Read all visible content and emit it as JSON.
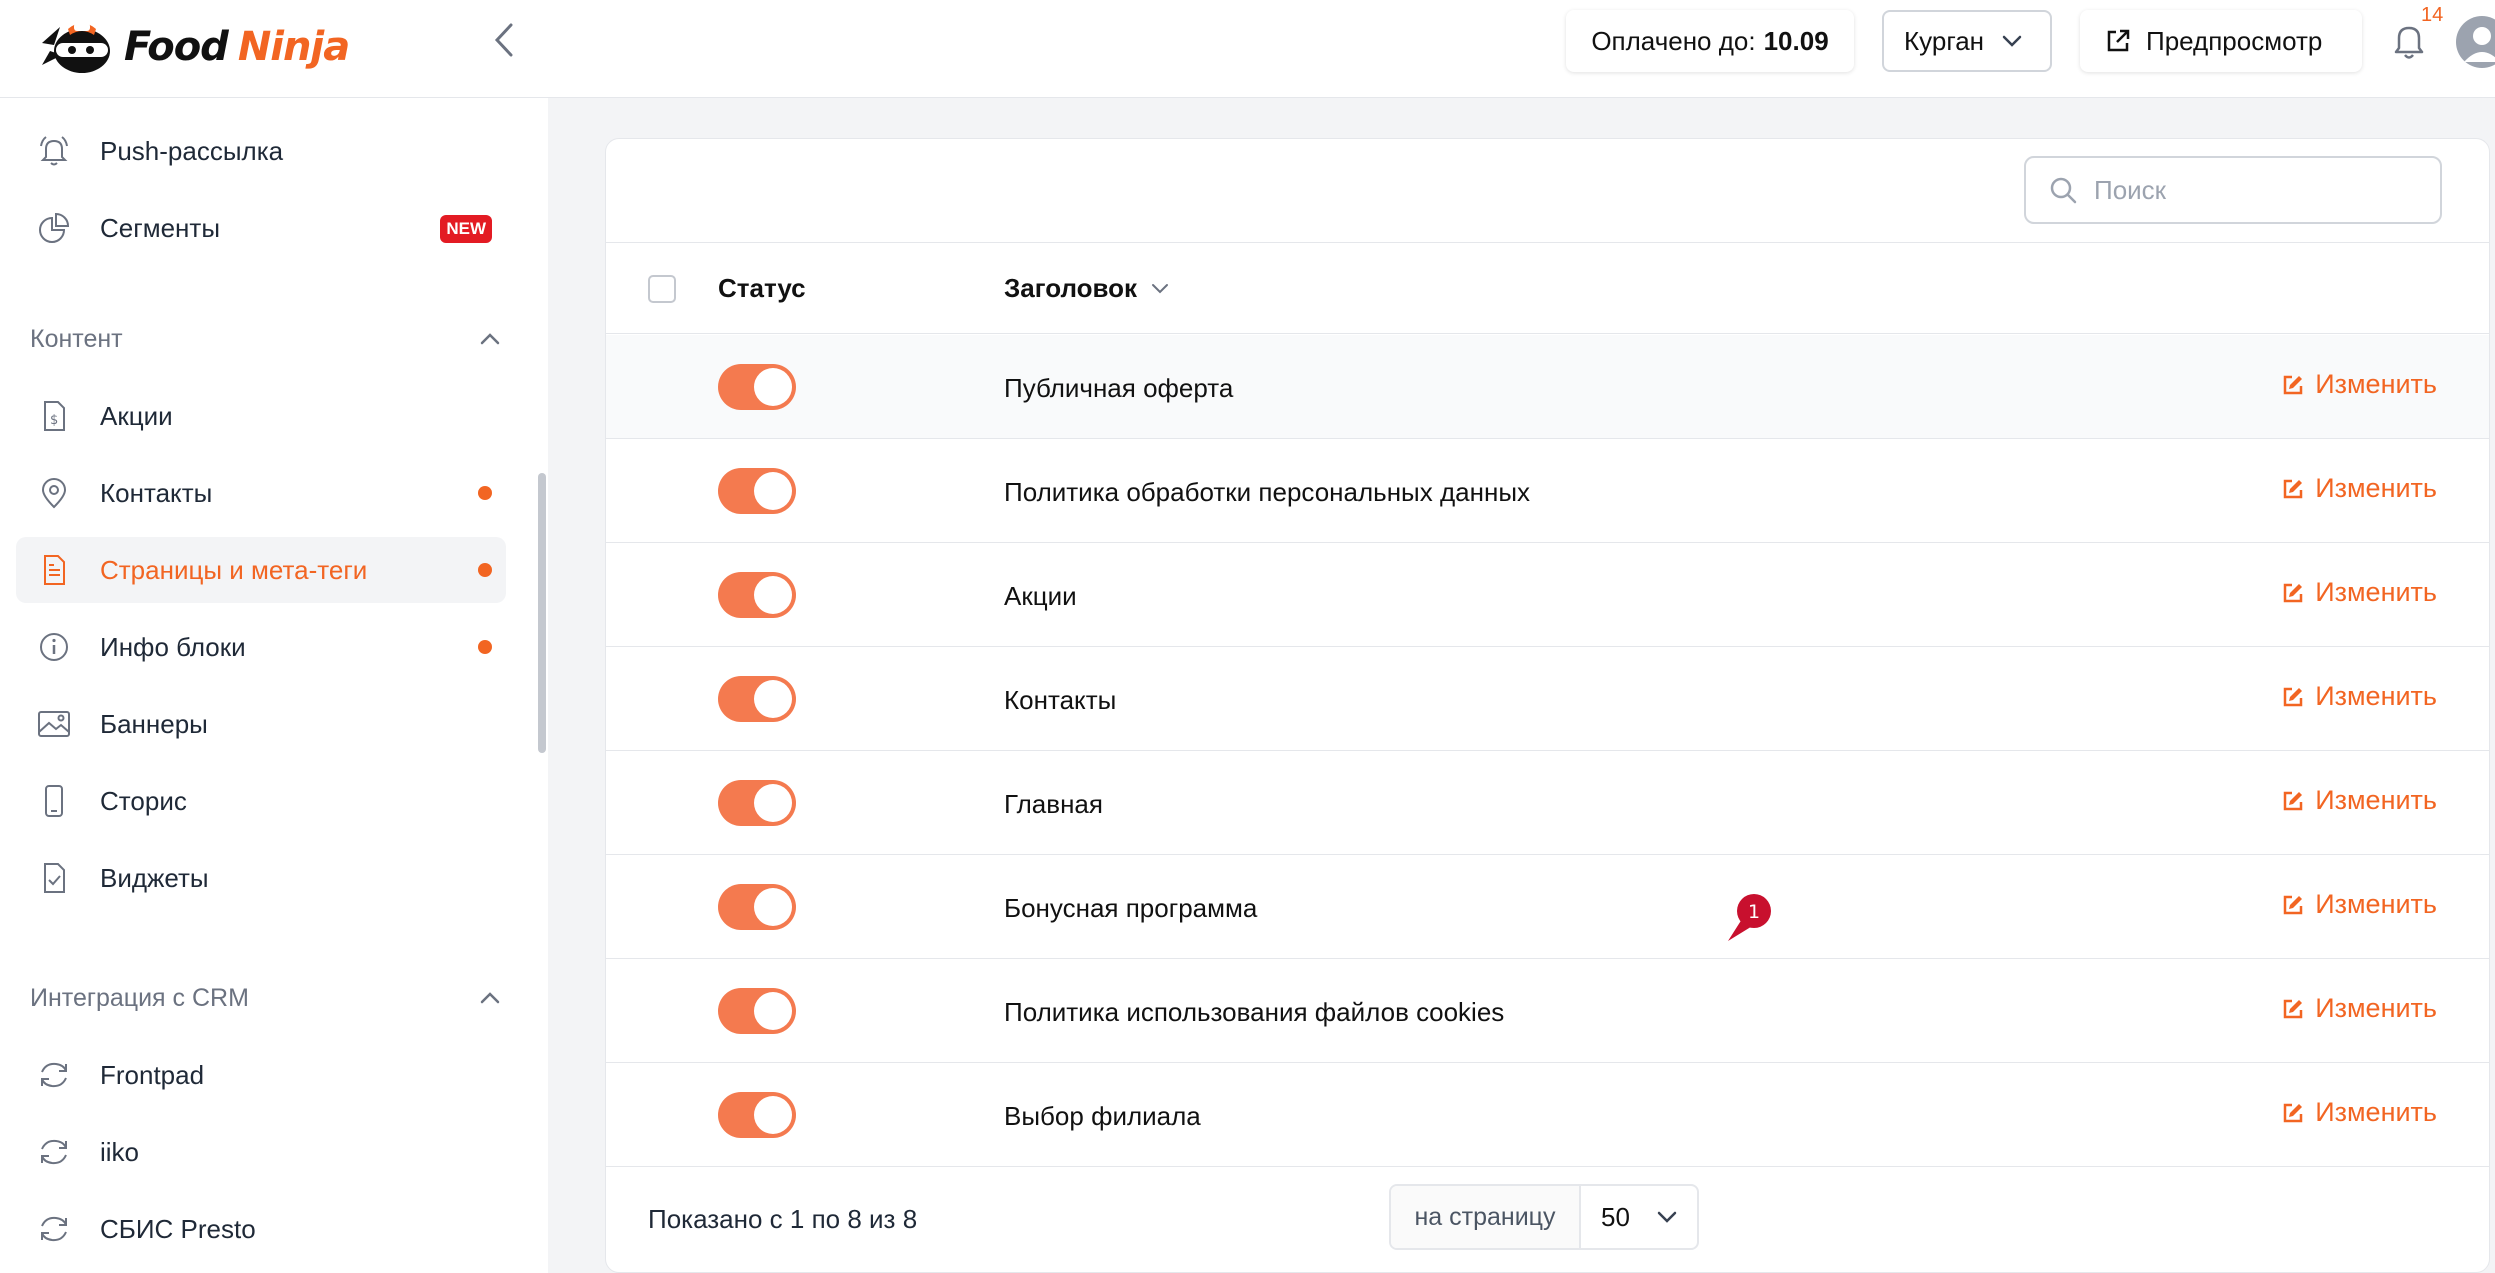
{
  "header": {
    "logo_part1": "Food",
    "logo_part2": "Ninja",
    "paid_label": "Оплачено до:",
    "paid_date": "10.09",
    "city": "Курган",
    "preview_label": "Предпросмотр",
    "notification_count": "14"
  },
  "sidebar": {
    "items_top": [
      {
        "label": "Push-рассылка",
        "icon": "bell-icon"
      },
      {
        "label": "Сегменты",
        "icon": "pie-chart-icon",
        "badge": "NEW"
      }
    ],
    "content_section": "Контент",
    "content_items": [
      {
        "label": "Акции",
        "icon": "dollar-file-icon"
      },
      {
        "label": "Контакты",
        "icon": "map-pin-icon"
      },
      {
        "label": "Страницы и мета-теги",
        "icon": "document-icon"
      },
      {
        "label": "Инфо блоки",
        "icon": "info-icon"
      },
      {
        "label": "Баннеры",
        "icon": "image-icon"
      },
      {
        "label": "Сторис",
        "icon": "phone-icon"
      },
      {
        "label": "Виджеты",
        "icon": "check-file-icon"
      }
    ],
    "crm_section": "Интеграция с CRM",
    "crm_items": [
      {
        "label": "Frontpad",
        "icon": "sync-icon"
      },
      {
        "label": "iiko",
        "icon": "sync-icon"
      },
      {
        "label": "СБИС Presto",
        "icon": "sync-icon"
      }
    ]
  },
  "main": {
    "search_placeholder": "Поиск",
    "col_status": "Статус",
    "col_title": "Заголовок",
    "edit_label": "Изменить",
    "rows": [
      {
        "title": "Публичная оферта",
        "status": "on"
      },
      {
        "title": "Политика обработки персональных данных",
        "status": "on"
      },
      {
        "title": "Акции",
        "status": "on"
      },
      {
        "title": "Контакты",
        "status": "on"
      },
      {
        "title": "Главная",
        "status": "on"
      },
      {
        "title": "Бонусная программа",
        "status": "on"
      },
      {
        "title": "Политика использования файлов cookies",
        "status": "on"
      },
      {
        "title": "Выбор филиала",
        "status": "on"
      }
    ],
    "marker_label": "1",
    "shown_text": "Показано с 1 по 8 из 8",
    "per_page_label": "на страницу",
    "per_page_value": "50"
  },
  "colors": {
    "accent": "#f26522",
    "toggle_on": "#f47a4f",
    "badge_red": "#e31b23"
  }
}
